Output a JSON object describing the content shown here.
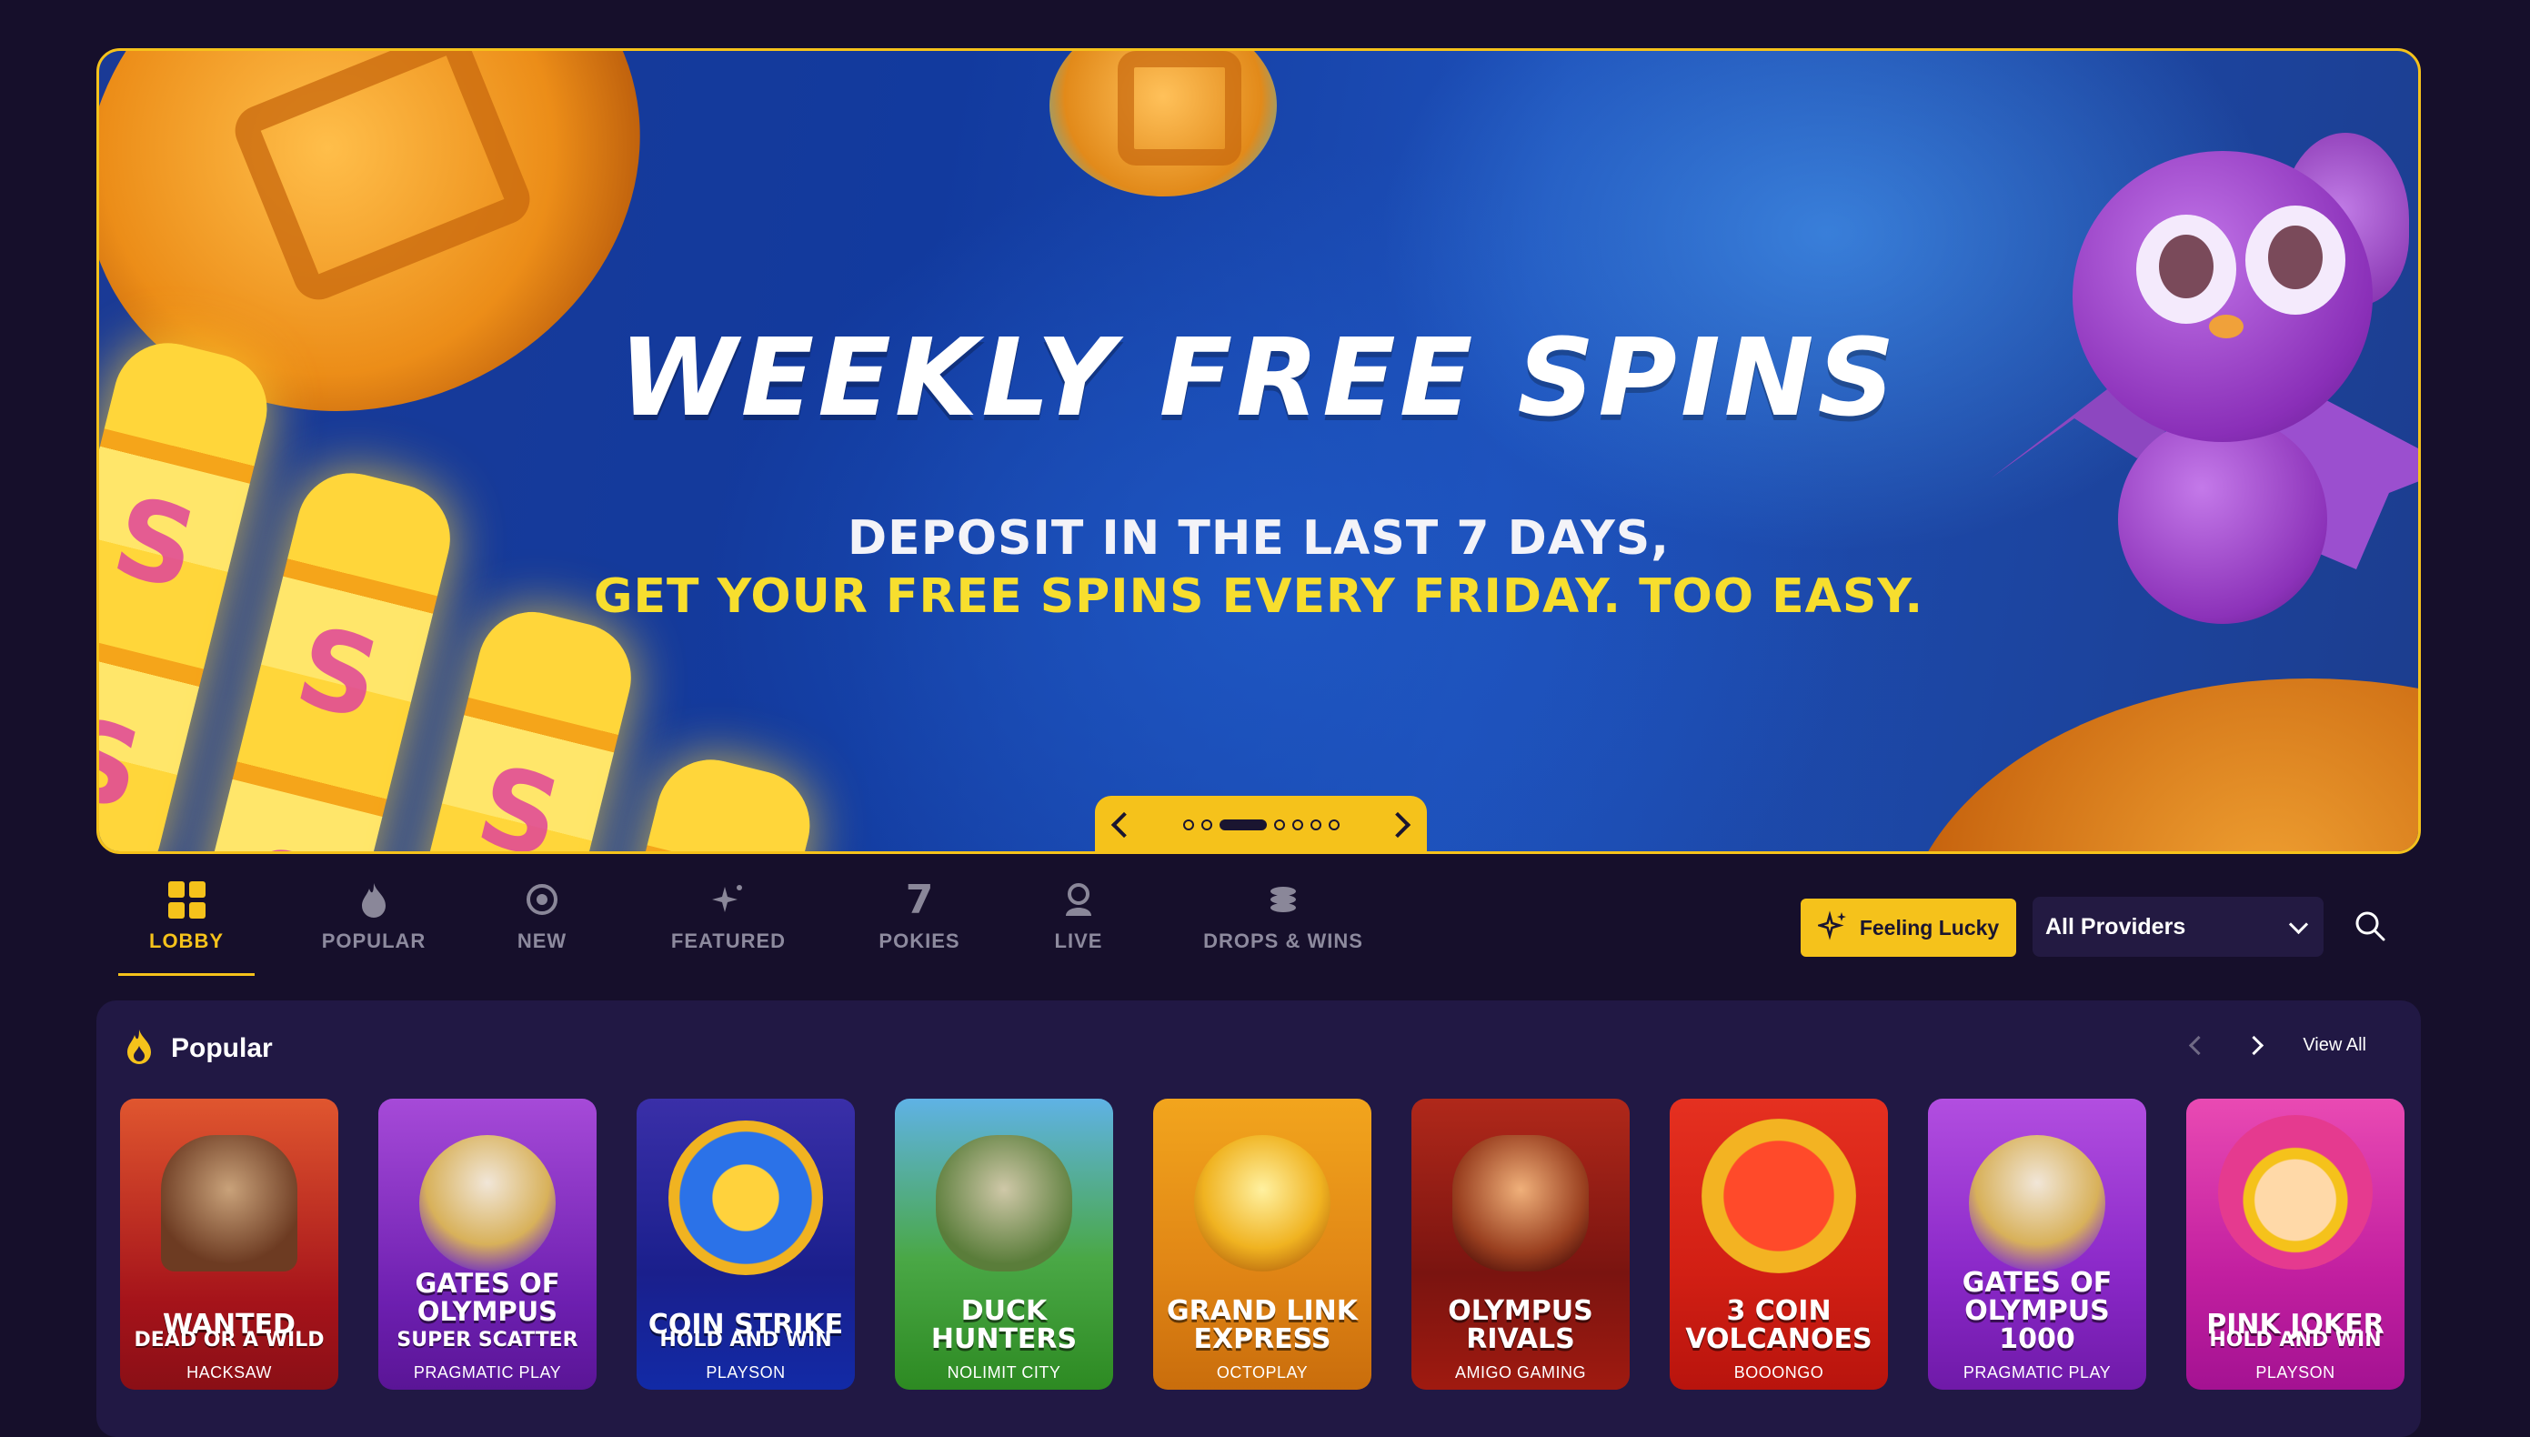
{
  "banner": {
    "title": "WEEKLY FREE SPINS",
    "line1": "DEPOSIT IN THE LAST 7 DAYS,",
    "line2": "GET YOUR FREE SPINS EVERY FRIDAY. TOO EASY.",
    "slide_count": 7,
    "active_slide": 3
  },
  "tabs": [
    {
      "label": "LOBBY",
      "icon": "grid-icon",
      "active": true
    },
    {
      "label": "POPULAR",
      "icon": "flame-icon"
    },
    {
      "label": "NEW",
      "icon": "sparkle-circle-icon"
    },
    {
      "label": "FEATURED",
      "icon": "star-sparkle-icon"
    },
    {
      "label": "POKIES",
      "icon": "seven-icon"
    },
    {
      "label": "LIVE",
      "icon": "dealer-icon"
    },
    {
      "label": "DROPS & WINS",
      "icon": "coin-stack-icon"
    }
  ],
  "toolbar": {
    "lucky_label": "Feeling Lucky",
    "providers_value": "All Providers"
  },
  "popular": {
    "title": "Popular",
    "view_all": "View All",
    "games": [
      {
        "name": "WANTED",
        "sub": "DEAD OR A WILD",
        "provider": "HACKSAW"
      },
      {
        "name": "GATES OF OLYMPUS",
        "sub": "SUPER SCATTER",
        "provider": "PRAGMATIC PLAY"
      },
      {
        "name": "COIN STRIKE",
        "sub": "HOLD AND WIN",
        "provider": "PLAYSON"
      },
      {
        "name": "DUCK HUNTERS",
        "sub": "",
        "provider": "NOLIMIT CITY"
      },
      {
        "name": "GRAND LINK EXPRESS",
        "sub": "",
        "provider": "OCTOPLAY"
      },
      {
        "name": "OLYMPUS RIVALS",
        "sub": "",
        "provider": "AMIGO GAMING"
      },
      {
        "name": "3 COIN VOLCANOES",
        "sub": "",
        "provider": "BOOONGO"
      },
      {
        "name": "GATES OF OLYMPUS 1000",
        "sub": "",
        "provider": "PRAGMATIC PLAY"
      },
      {
        "name": "PINK JOKER",
        "sub": "HOLD AND WIN",
        "provider": "PLAYSON"
      }
    ]
  },
  "colors": {
    "accent": "#f5c21b",
    "background": "#160f2b",
    "panel": "#211844"
  }
}
